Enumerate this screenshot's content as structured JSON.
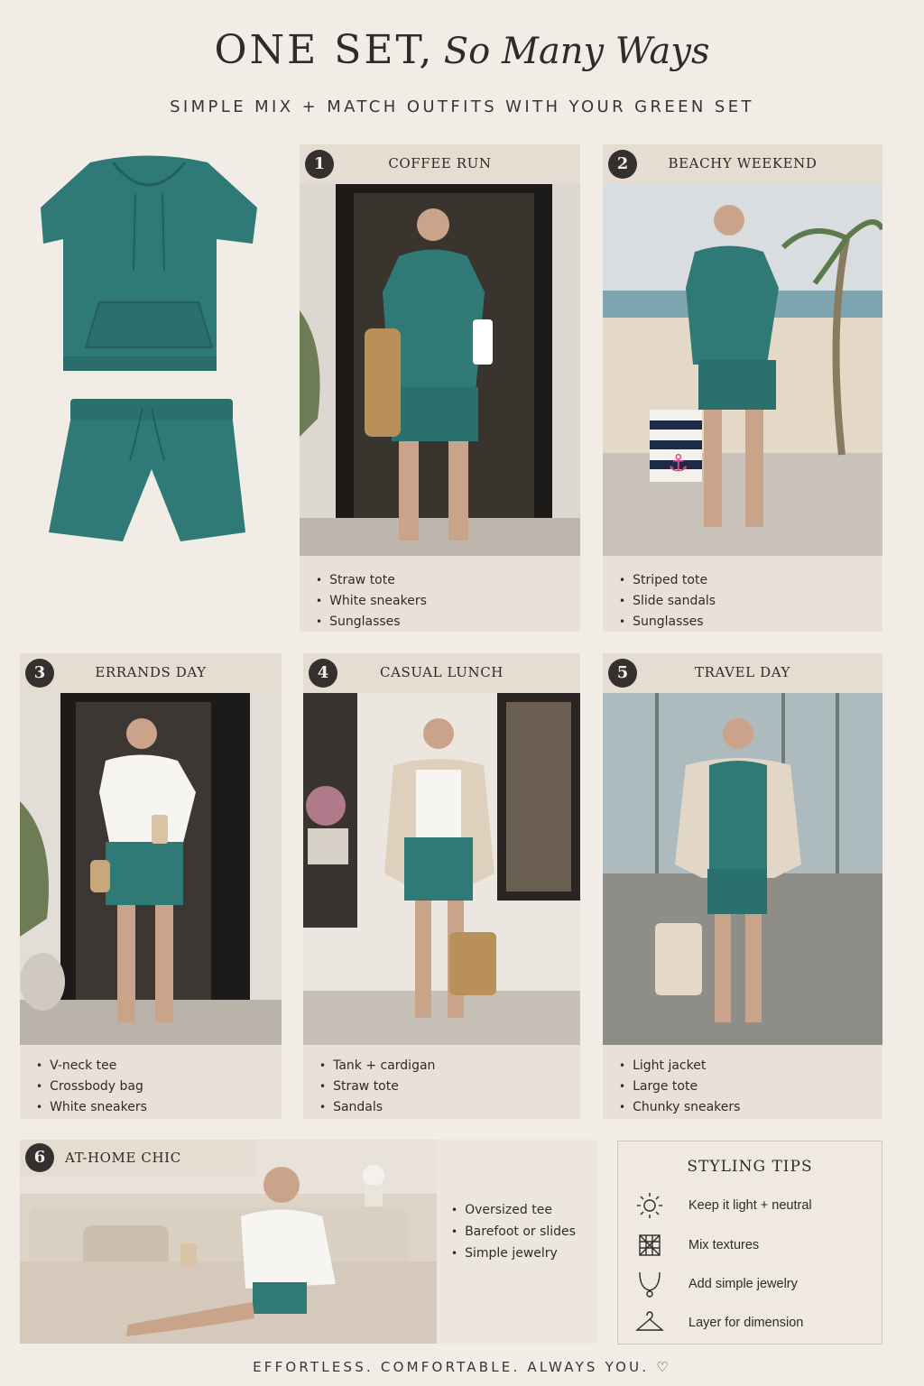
{
  "header": {
    "title": "ONE SET,",
    "title_script": "So Many Ways",
    "subtitle": "SIMPLE MIX + MATCH OUTFITS WITH YOUR GREEN SET"
  },
  "colors": {
    "set_green": "#2f7a77",
    "background": "#f1ece6",
    "card": "#e9e1d8",
    "badge": "#34302d"
  },
  "outfits": [
    {
      "number": "1",
      "title": "COFFEE RUN",
      "items": [
        "Straw tote",
        "White sneakers",
        "Sunglasses"
      ]
    },
    {
      "number": "2",
      "title": "BEACHY WEEKEND",
      "items": [
        "Striped tote",
        "Slide sandals",
        "Sunglasses"
      ]
    },
    {
      "number": "3",
      "title": "ERRANDS DAY",
      "items": [
        "V-neck tee",
        "Crossbody bag",
        "White sneakers"
      ]
    },
    {
      "number": "4",
      "title": "CASUAL LUNCH",
      "items": [
        "Tank + cardigan",
        "Straw tote",
        "Sandals"
      ]
    },
    {
      "number": "5",
      "title": "TRAVEL DAY",
      "items": [
        "Light jacket",
        "Large tote",
        "Chunky sneakers"
      ]
    },
    {
      "number": "6",
      "title": "AT-HOME CHIC",
      "items": [
        "Oversized tee",
        "Barefoot or slides",
        "Simple jewelry"
      ]
    }
  ],
  "tips": {
    "title": "STYLING TIPS",
    "items": [
      {
        "icon": "sun-icon",
        "label": "Keep it light + neutral"
      },
      {
        "icon": "texture-grid-icon",
        "label": "Mix textures"
      },
      {
        "icon": "necklace-icon",
        "label": "Add simple jewelry"
      },
      {
        "icon": "hanger-icon",
        "label": "Layer for dimension"
      }
    ]
  },
  "footer": "EFFORTLESS. COMFORTABLE. ALWAYS YOU. ♡"
}
